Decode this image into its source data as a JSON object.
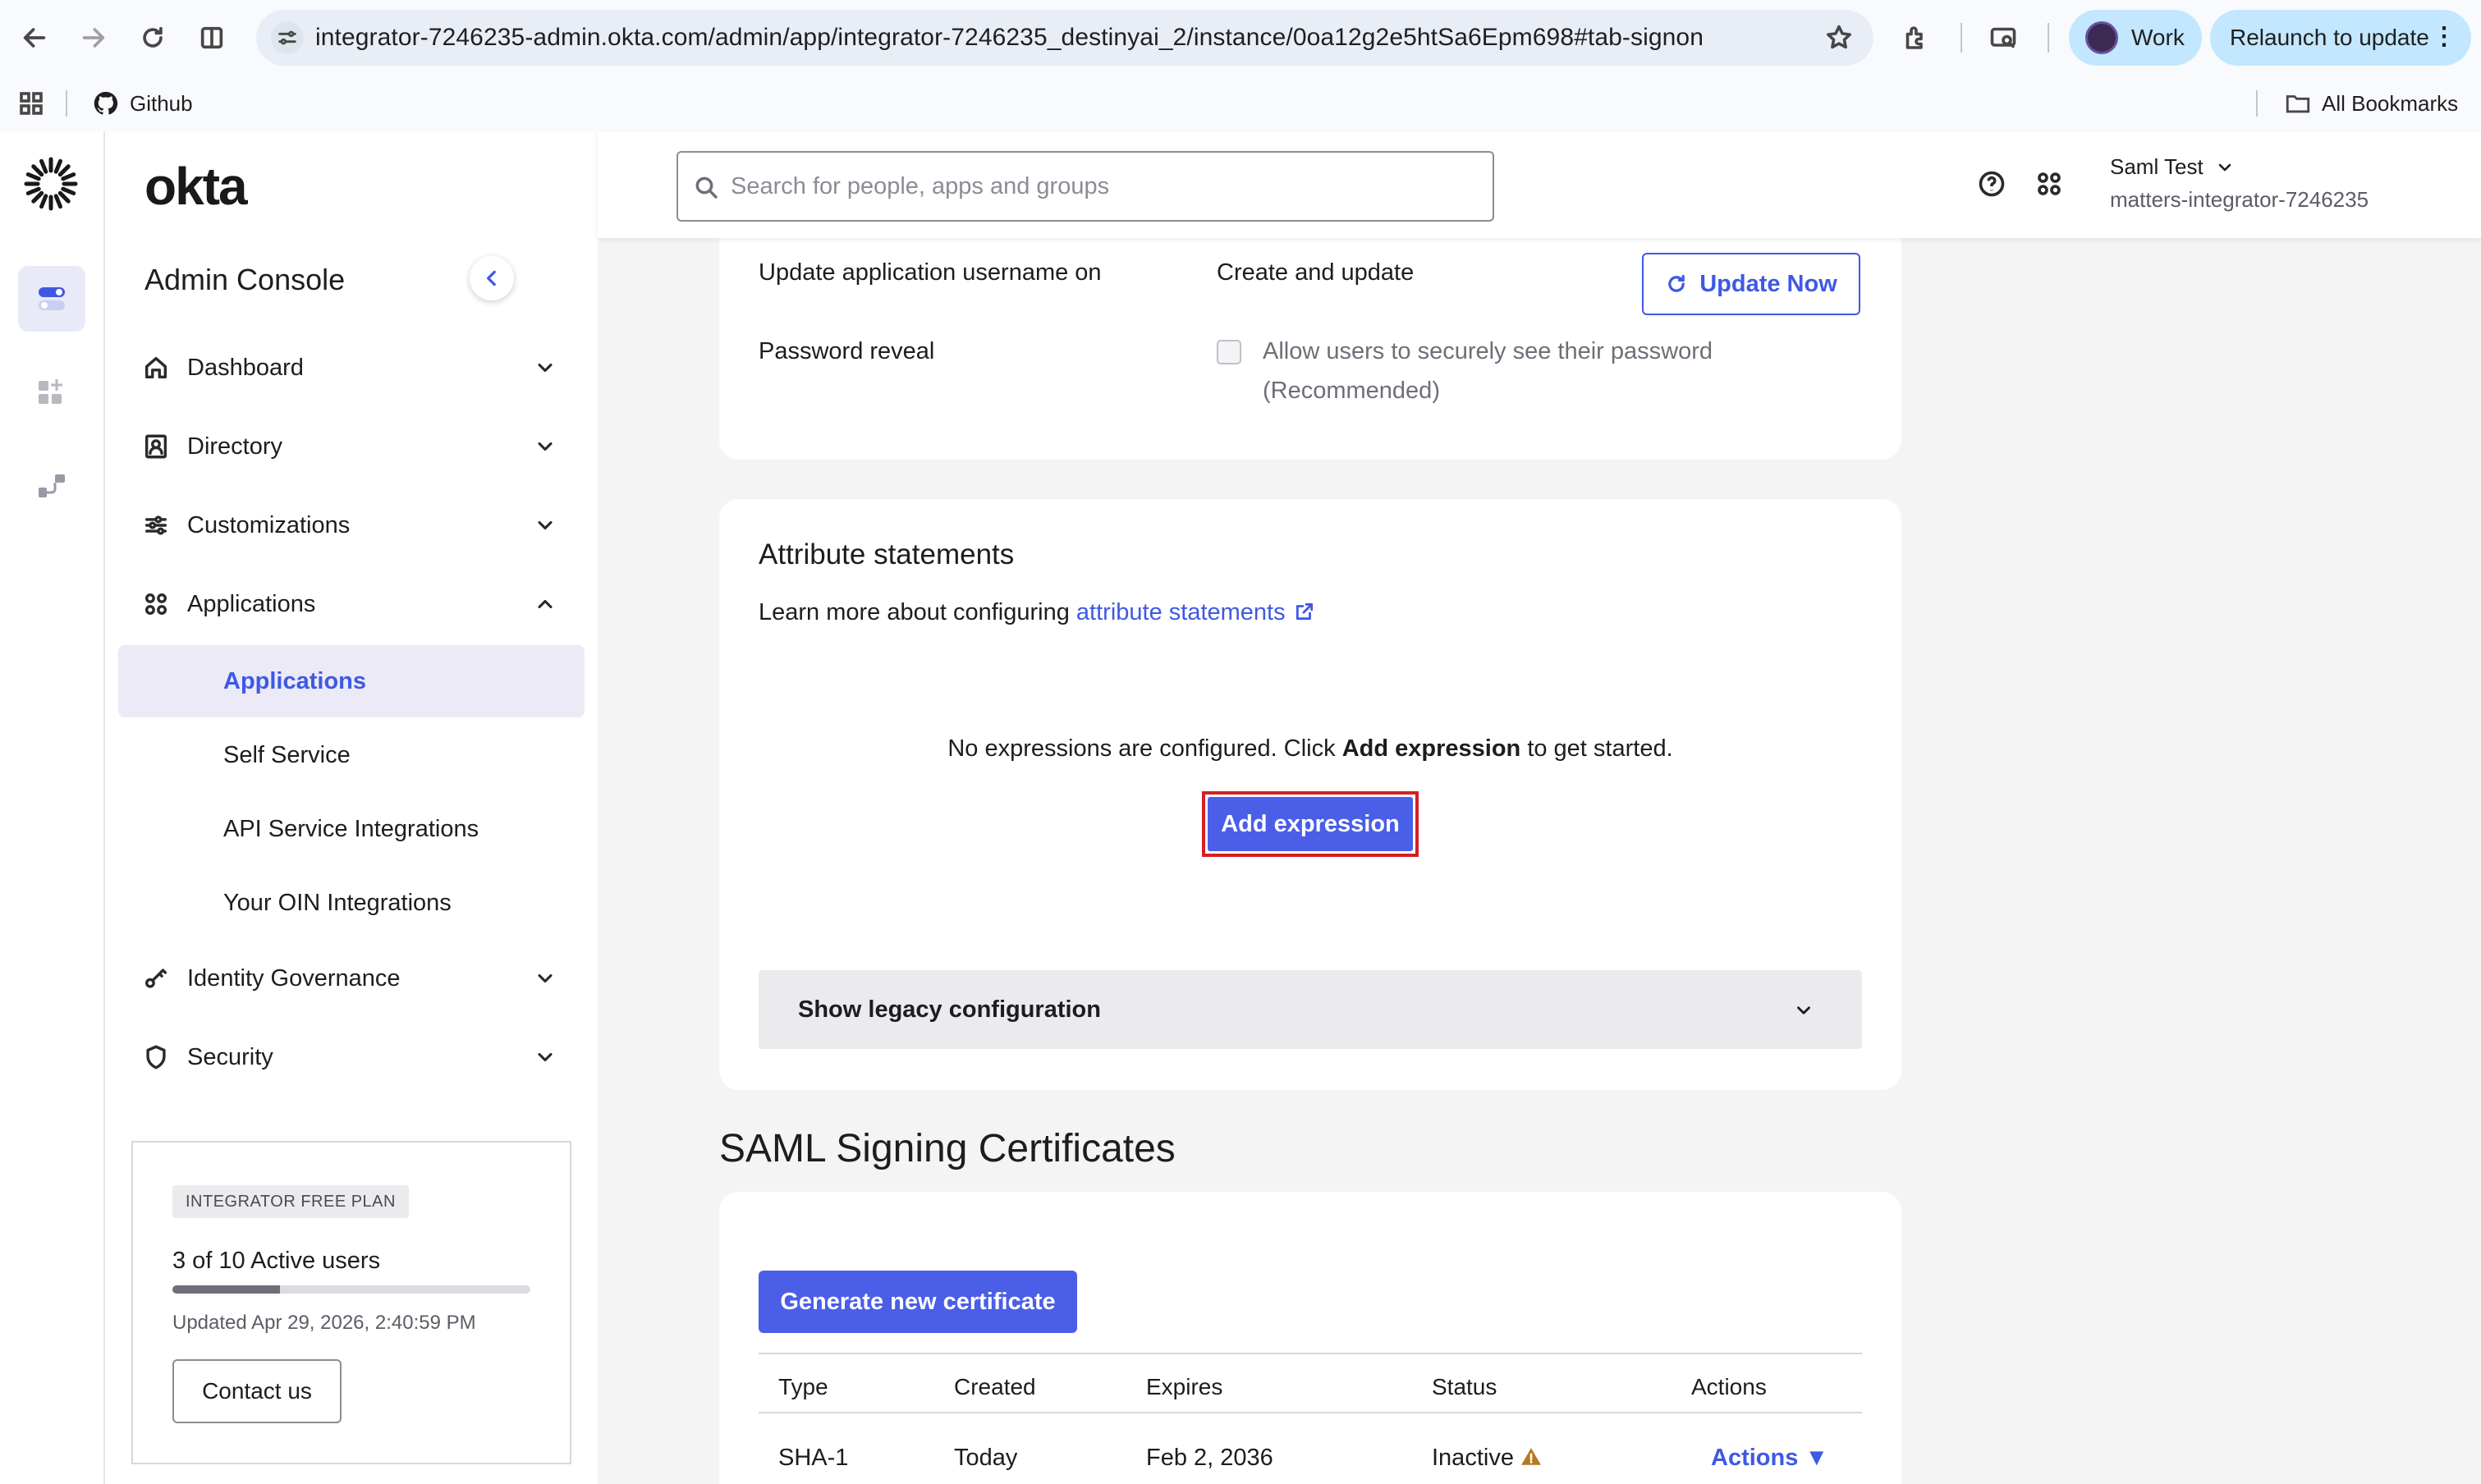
{
  "browser": {
    "url": "integrator-7246235-admin.okta.com/admin/app/integrator-7246235_destinyai_2/instance/0oa12g2e5htSa6Epm698#tab-signon",
    "profile_label": "Work",
    "relaunch_label": "Relaunch to update",
    "bookmarks": {
      "github_label": "Github",
      "all_bookmarks_label": "All Bookmarks"
    }
  },
  "sidebar": {
    "logo_text": "okta",
    "title": "Admin Console",
    "nav": [
      {
        "label": "Dashboard"
      },
      {
        "label": "Directory"
      },
      {
        "label": "Customizations"
      },
      {
        "label": "Applications"
      },
      {
        "label": "Identity Governance"
      },
      {
        "label": "Security"
      }
    ],
    "app_subitems": [
      {
        "label": "Applications"
      },
      {
        "label": "Self Service"
      },
      {
        "label": "API Service Integrations"
      },
      {
        "label": "Your OIN Integrations"
      }
    ],
    "plan": {
      "badge": "INTEGRATOR FREE PLAN",
      "users": "3 of 10 Active users",
      "users_fraction": 0.3,
      "updated": "Updated Apr 29, 2026, 2:40:59 PM",
      "contact_label": "Contact us"
    }
  },
  "topbar": {
    "search_placeholder": "Search for people, apps and groups",
    "user_name": "Saml Test",
    "user_org": "matters-integrator-7246235"
  },
  "credentials": {
    "update_username_label": "Update application username on",
    "update_username_value": "Create and update",
    "update_now_label": "Update Now",
    "password_reveal_label": "Password reveal",
    "password_reveal_option_line1": "Allow users to securely see their password",
    "password_reveal_option_line2": "(Recommended)"
  },
  "attributes": {
    "title": "Attribute statements",
    "learn_prefix": "Learn more about configuring",
    "learn_link": "attribute statements",
    "empty_prefix": "No expressions are configured. Click",
    "empty_bold": "Add expression",
    "empty_suffix": "to get started.",
    "add_label": "Add expression",
    "legacy_label": "Show legacy configuration"
  },
  "certificates": {
    "title": "SAML Signing Certificates",
    "generate_label": "Generate new certificate",
    "columns": [
      "Type",
      "Created",
      "Expires",
      "Status",
      "Actions"
    ],
    "rows": [
      {
        "type": "SHA-1",
        "created": "Today",
        "expires": "Feb 2, 2036",
        "status": "Inactive",
        "actions": "Actions ▼"
      }
    ]
  },
  "colors": {
    "accent": "#3f59e4",
    "primary_button": "#4a5ee8",
    "highlight_border": "#d61f26",
    "warning": "#b7791f"
  }
}
